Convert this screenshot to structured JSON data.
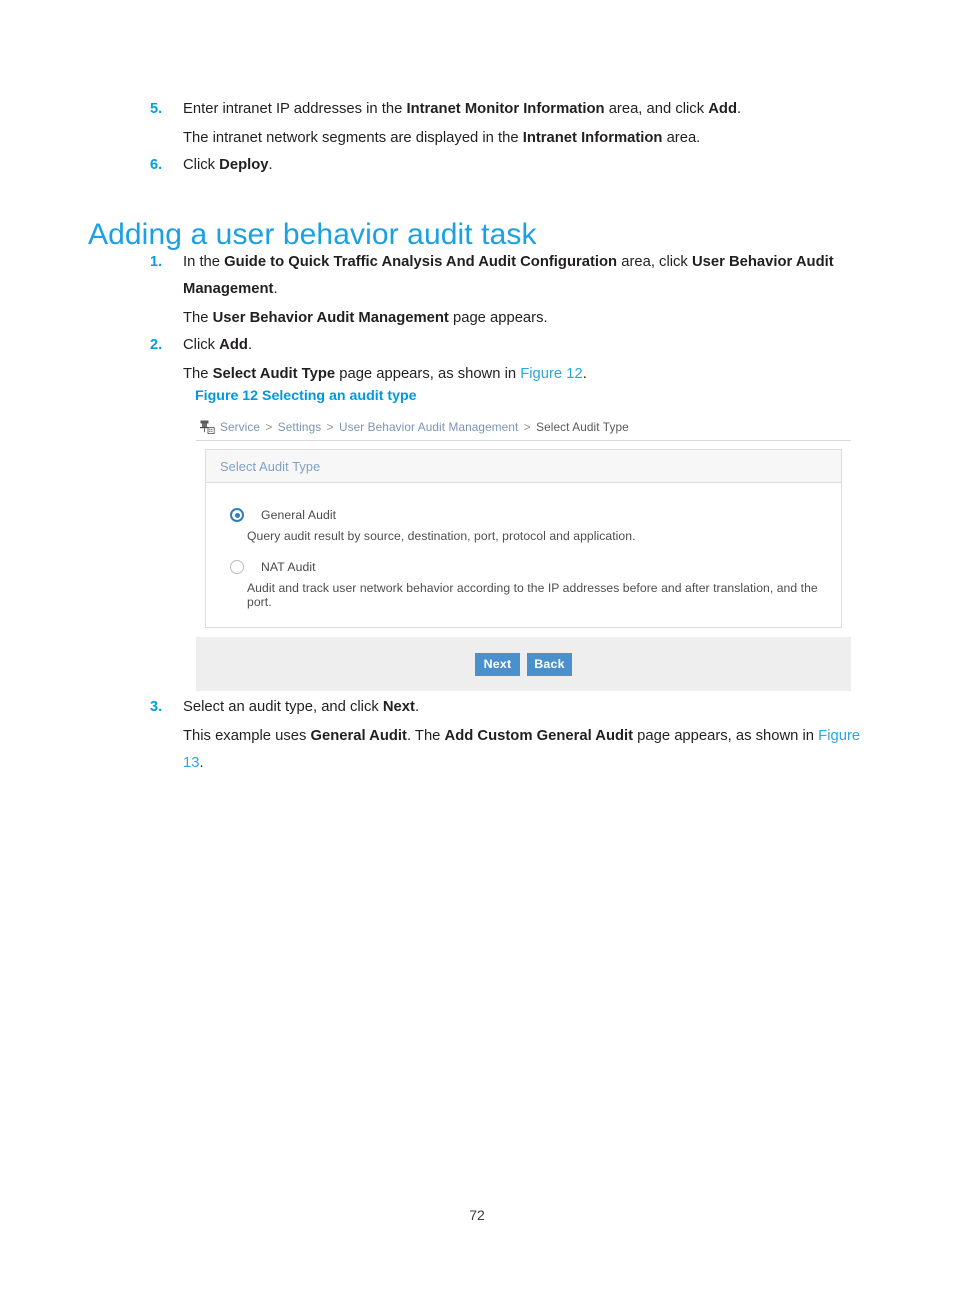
{
  "document": {
    "page_number": "72",
    "heading": "Adding a user behavior audit task"
  },
  "colors": {
    "accent_blue": "#1ba1e2",
    "caption_blue": "#0099dd",
    "list_number_blue": "#00a0df",
    "xref_blue": "#29a7e1",
    "button_blue": "#4a90cc",
    "radio_selected": "#2e7ebb",
    "footer_gray": "#eeeeee",
    "panel_header_gray": "#f7f7f7"
  },
  "top_steps": [
    {
      "number": "5.",
      "parts": [
        {
          "t": "Enter intranet IP addresses in the ",
          "b": false
        },
        {
          "t": "Intranet Monitor Information",
          "b": true
        },
        {
          "t": " area, and click ",
          "b": false
        },
        {
          "t": "Add",
          "b": true
        },
        {
          "t": ".",
          "b": false
        }
      ],
      "sub": [
        {
          "t": "The intranet network segments are displayed in the ",
          "b": false
        },
        {
          "t": "Intranet Information",
          "b": true
        },
        {
          "t": " area.",
          "b": false
        }
      ]
    },
    {
      "number": "6.",
      "parts": [
        {
          "t": "Click ",
          "b": false
        },
        {
          "t": "Deploy",
          "b": true
        },
        {
          "t": ".",
          "b": false
        }
      ],
      "sub": []
    }
  ],
  "section_steps": [
    {
      "number": "1.",
      "parts": [
        {
          "t": "In the ",
          "b": false
        },
        {
          "t": "Guide to Quick Traffic Analysis And Audit Configuration",
          "b": true
        },
        {
          "t": " area, click ",
          "b": false
        },
        {
          "t": "User Behavior Audit Management",
          "b": true
        },
        {
          "t": ".",
          "b": false
        }
      ],
      "sub": [
        {
          "t": "The ",
          "b": false
        },
        {
          "t": "User Behavior Audit Management",
          "b": true
        },
        {
          "t": " page appears.",
          "b": false
        }
      ]
    },
    {
      "number": "2.",
      "parts": [
        {
          "t": "Click ",
          "b": false
        },
        {
          "t": "Add",
          "b": true
        },
        {
          "t": ".",
          "b": false
        }
      ],
      "sub": [
        {
          "t": "The ",
          "b": false
        },
        {
          "t": "Select Audit Type",
          "b": true
        },
        {
          "t": " page appears, as shown in ",
          "b": false
        },
        {
          "t": "Figure 12",
          "b": false,
          "x": true
        },
        {
          "t": ".",
          "b": false
        }
      ]
    }
  ],
  "bottom_steps": [
    {
      "number": "3.",
      "parts": [
        {
          "t": "Select an audit type, and click ",
          "b": false
        },
        {
          "t": "Next",
          "b": true
        },
        {
          "t": ".",
          "b": false
        }
      ],
      "sub": [
        {
          "t": "This example uses ",
          "b": false
        },
        {
          "t": "General Audit",
          "b": true
        },
        {
          "t": ". The ",
          "b": false
        },
        {
          "t": "Add Custom General Audit",
          "b": true
        },
        {
          "t": " page appears, as shown in ",
          "b": false
        },
        {
          "t": "Figure 13",
          "b": false,
          "x": true
        },
        {
          "t": ".",
          "b": false
        }
      ]
    }
  ],
  "figure": {
    "caption": "Figure 12 Selecting an audit type",
    "breadcrumb": {
      "icon": "network-server-icon",
      "items": [
        {
          "label": "Service",
          "link": true
        },
        {
          "label": "Settings",
          "link": true
        },
        {
          "label": "User Behavior Audit Management",
          "link": true
        },
        {
          "label": "Select Audit Type",
          "link": false
        }
      ],
      "separator": ">"
    },
    "panel": {
      "title": "Select Audit Type",
      "options": [
        {
          "label": "General Audit",
          "description": "Query audit result by source, destination, port, protocol and application.",
          "selected": true
        },
        {
          "label": "NAT Audit",
          "description": "Audit and track user network behavior according to the IP addresses before and after translation, and the port.",
          "selected": false
        }
      ]
    },
    "buttons": [
      {
        "label": "Next"
      },
      {
        "label": "Back"
      }
    ]
  }
}
